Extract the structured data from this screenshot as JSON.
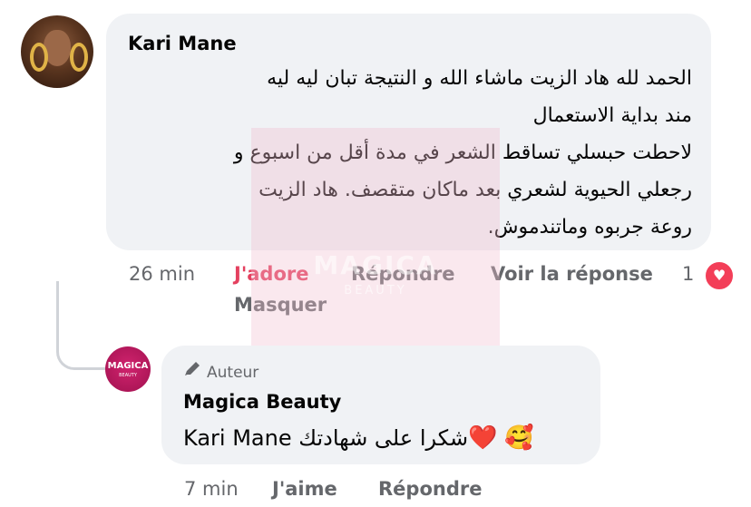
{
  "comment": {
    "author": "Kari Mane",
    "lines": [
      "الحمد لله هاد الزيت ماشاء الله و النتيجة تبان ليه ليه",
      "مند بداية الاستعمال",
      "لاحطت حبسلي تساقط الشعر في مدة أقل من اسبوع و",
      "رجعلي الحيوية لشعري بعد ماكان متقصف. هاد الزيت",
      "روعة جربوه وماتندموش."
    ],
    "time": "26 min",
    "reaction_label": "J'adore",
    "reply_label": "Répondre",
    "view_reply_label": "Voir la réponse",
    "hide_label": "Masquer",
    "reaction_count": "1",
    "accent_color": "#e4405f"
  },
  "reply": {
    "badge": "Auteur",
    "author": "Magica Beauty",
    "avatar_text": "MAGICA",
    "avatar_sub": "BEAUTY",
    "text": "شكرا على شهادتك",
    "mention": "Kari Mane",
    "emoji_heart": "❤️",
    "emoji_face": "🥰",
    "time": "7 min",
    "like_label": "J'aime",
    "reply_label": "Répondre"
  },
  "watermark": {
    "text": "MAGICA",
    "sub": "BEAUTY"
  },
  "icons": {
    "heart": "heart-icon",
    "pen": "pencil-icon"
  }
}
